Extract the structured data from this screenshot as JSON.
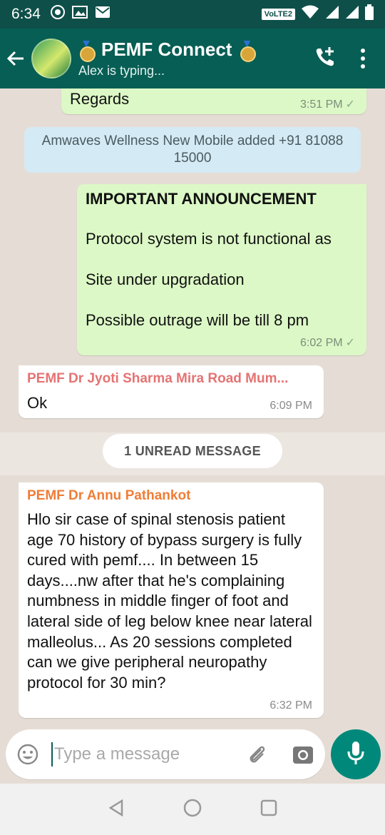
{
  "statusbar": {
    "time": "6:34",
    "volte": "VoLTE2"
  },
  "header": {
    "title": "PEMF Connect",
    "subtitle": "Alex is typing..."
  },
  "messages": {
    "m1": {
      "text": "Regards",
      "time": "3:51 PM"
    },
    "system": {
      "text": "Amwaves Wellness New Mobile added +91 81088 15000"
    },
    "m2": {
      "heading": "IMPORTANT ANNOUNCEMENT",
      "line1": "Protocol system is not functional as",
      "line2": "Site under upgradation",
      "line3": "Possible outrage will be till 8 pm",
      "time": "6:02 PM"
    },
    "m3": {
      "sender": "PEMF Dr Jyoti Sharma Mira Road Mum...",
      "text": "Ok",
      "time": "6:09 PM"
    },
    "unread": "1 UNREAD MESSAGE",
    "m4": {
      "sender": "PEMF Dr Annu Pathankot",
      "text": "Hlo sir case of spinal stenosis patient age 70 history of bypass surgery is fully cured with pemf.... In between 15 days....nw after that he's complaining numbness in middle finger  of foot and lateral side of leg below knee near lateral malleolus... As 20 sessions completed can we give peripheral neuropathy protocol for 30 min?",
      "time": "6:32 PM"
    }
  },
  "input": {
    "placeholder": "Type a message"
  },
  "colors": {
    "header": "#075e54",
    "statusbar": "#0f4f49",
    "outgoing": "#dcf8c6",
    "incoming": "#ffffff",
    "sender_jyoti": "#e57373",
    "sender_annu": "#ef7d37",
    "mic": "#00897b"
  },
  "icons": [
    "back-arrow-icon",
    "group-avatar",
    "medal-icon",
    "add-call-icon",
    "more-vert-icon",
    "emoji-icon",
    "attach-icon",
    "camera-icon",
    "mic-icon",
    "nav-back-icon",
    "nav-home-icon",
    "nav-recents-icon"
  ]
}
